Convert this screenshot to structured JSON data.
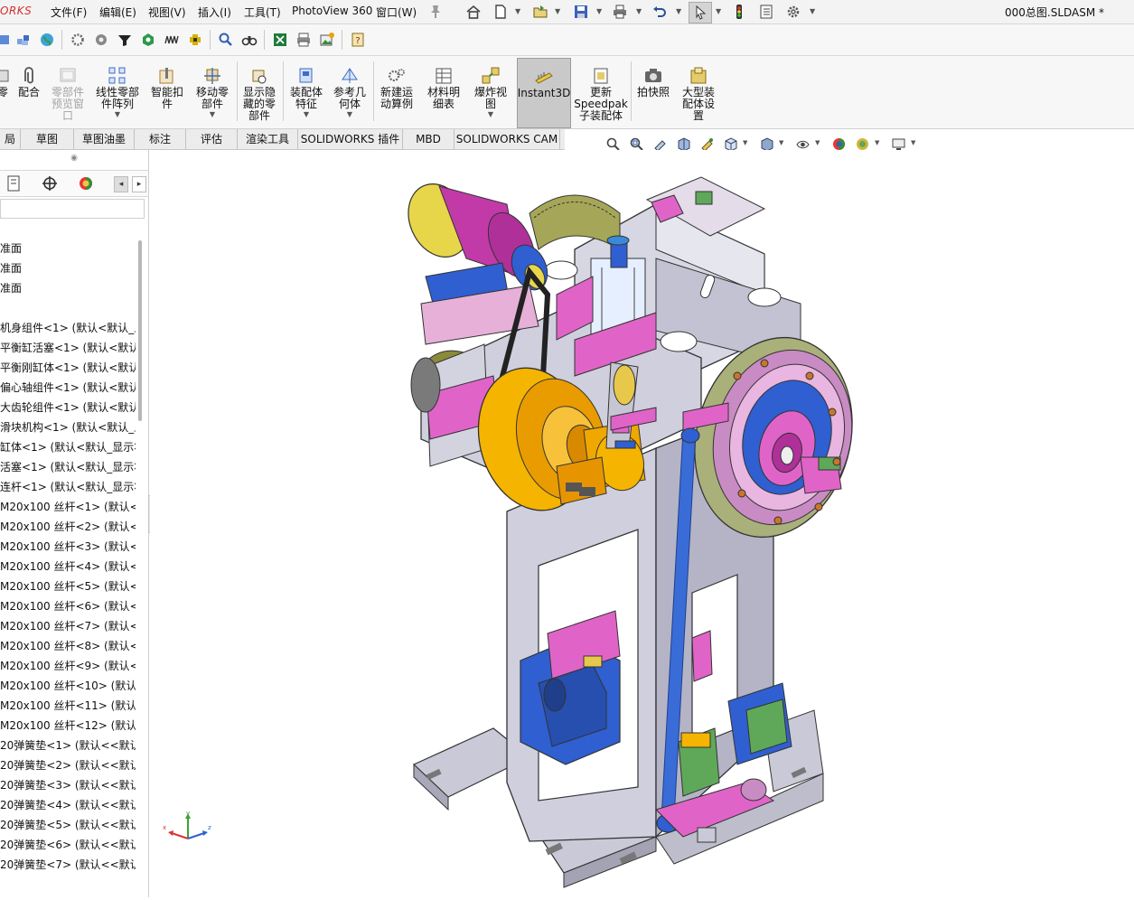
{
  "app": {
    "brand": "ORKS",
    "document_title": "000总图.SLDASM *"
  },
  "menu": [
    "文件(F)",
    "编辑(E)",
    "视图(V)",
    "插入(I)",
    "工具(T)",
    "PhotoView 360",
    "窗口(W)"
  ],
  "quick_access_icons": [
    "home-icon",
    "new-document-icon",
    "open-file-icon",
    "save-icon",
    "print-icon",
    "undo-icon",
    "select-pointer-icon",
    "traffic-light-icon",
    "file-properties-icon",
    "options-gear-icon"
  ],
  "toolbar2_icons": [
    "assembly-icon",
    "component-icon",
    "globe-icon",
    "settings-gear-icon",
    "gear-part-icon",
    "funnel-icon",
    "target-icon",
    "wave-icon",
    "plug-icon",
    "zoom-find-icon",
    "binoculars-icon",
    "excel-icon",
    "printer-icon",
    "image-import-icon",
    "help-book-icon"
  ],
  "command_manager": [
    {
      "id": "cmd-part",
      "label": "零",
      "icon": "part-icon",
      "has_dropdown": false,
      "disabled": false
    },
    {
      "id": "cmd-mate",
      "label": "配合",
      "icon": "paperclip-icon",
      "has_dropdown": false,
      "disabled": false
    },
    {
      "id": "cmd-preview",
      "label": "零部件\n预览窗\n口",
      "icon": "preview-window-icon",
      "has_dropdown": false,
      "disabled": true
    },
    {
      "id": "cmd-linear-pattern",
      "label": "线性零部\n件阵列",
      "icon": "linear-pattern-icon",
      "has_dropdown": true,
      "disabled": false
    },
    {
      "id": "cmd-smart-fastener",
      "label": "智能扣\n件",
      "icon": "smart-fastener-icon",
      "has_dropdown": false,
      "disabled": false
    },
    {
      "id": "cmd-move-component",
      "label": "移动零\n部件",
      "icon": "move-component-icon",
      "has_dropdown": true,
      "disabled": false
    },
    {
      "id": "cmd-show-hidden",
      "label": "显示隐\n藏的零\n部件",
      "icon": "show-hidden-icon",
      "has_dropdown": false,
      "disabled": false
    },
    {
      "id": "cmd-assembly-feature",
      "label": "装配体\n特征",
      "icon": "assembly-feature-icon",
      "has_dropdown": true,
      "disabled": false
    },
    {
      "id": "cmd-reference-geometry",
      "label": "参考几\n何体",
      "icon": "reference-geometry-icon",
      "has_dropdown": true,
      "disabled": false
    },
    {
      "id": "cmd-motion-study",
      "label": "新建运\n动算例",
      "icon": "motion-study-icon",
      "has_dropdown": false,
      "disabled": false
    },
    {
      "id": "cmd-bom",
      "label": "材料明\n细表",
      "icon": "bom-icon",
      "has_dropdown": false,
      "disabled": false
    },
    {
      "id": "cmd-exploded-view",
      "label": "爆炸视\n图",
      "icon": "exploded-view-icon",
      "has_dropdown": true,
      "disabled": false
    },
    {
      "id": "cmd-instant3d",
      "label": "Instant3D",
      "icon": "instant3d-icon",
      "has_dropdown": false,
      "disabled": false,
      "active": true
    },
    {
      "id": "cmd-speedpak",
      "label": "更新\nSpeedpak\n子装配体",
      "icon": "speedpak-icon",
      "has_dropdown": false,
      "disabled": false
    },
    {
      "id": "cmd-snapshot",
      "label": "拍快照",
      "icon": "camera-icon",
      "has_dropdown": false,
      "disabled": false
    },
    {
      "id": "cmd-large-assembly",
      "label": "大型装\n配体设\n置",
      "icon": "large-assembly-icon",
      "has_dropdown": false,
      "disabled": false
    }
  ],
  "tabs": [
    "局",
    "草图",
    "草图油墨",
    "标注",
    "评估",
    "渲染工具",
    "SOLIDWORKS 插件",
    "MBD",
    "SOLIDWORKS CAM"
  ],
  "heads_up_icons": [
    "zoom-to-fit-icon",
    "zoom-area-icon",
    "previous-view-icon",
    "section-view-icon",
    "dynamic-annotation-icon",
    "view-orientation-icon",
    "display-style-icon",
    "hide-show-icon",
    "edit-appearance-icon",
    "apply-scene-icon",
    "view-settings-icon"
  ],
  "panel": {
    "collapse_glyph": "◉",
    "tab_icons": [
      "property-manager-icon",
      "config-manager-icon",
      "display-manager-icon"
    ],
    "nav_left": "◂",
    "nav_right": "▸"
  },
  "tree": [
    "准面",
    "准面",
    "准面",
    "",
    "机身组件<1> (默认<默认_显",
    "平衡缸活塞<1> (默认<默认",
    "平衡刚缸体<1> (默认<默认",
    "偏心轴组件<1> (默认<默认",
    "大齿轮组件<1> (默认<默认",
    "滑块机构<1> (默认<默认_显",
    "缸体<1> (默认<默认_显示状",
    "活塞<1> (默认<默认_显示状",
    "连杆<1> (默认<默认_显示状",
    "M20x100 丝杆<1> (默认<",
    "M20x100 丝杆<2> (默认<",
    "M20x100 丝杆<3> (默认<",
    "M20x100 丝杆<4> (默认<",
    "M20x100 丝杆<5> (默认<",
    "M20x100 丝杆<6> (默认<",
    "M20x100 丝杆<7> (默认<",
    "M20x100 丝杆<8> (默认<",
    "M20x100 丝杆<9> (默认<",
    "M20x100 丝杆<10> (默认<",
    "M20x100 丝杆<11> (默认<",
    "M20x100 丝杆<12> (默认<",
    "20弹簧垫<1> (默认<<默认",
    "20弹簧垫<2> (默认<<默认",
    "20弹簧垫<3> (默认<<默认",
    "20弹簧垫<4> (默认<<默认",
    "20弹簧垫<5> (默认<<默认",
    "20弹簧垫<6> (默认<<默认",
    "20弹簧垫<7> (默认<<默认"
  ],
  "triad": {
    "x": "x",
    "y": "y",
    "z": "z"
  },
  "colors": {
    "frame": "#c7c7d6",
    "motor_yellow": "#e8d64a",
    "motor_magenta": "#c23aa8",
    "flywheel": "#f5b400",
    "blue_parts": "#2f5fd0",
    "pink_parts": "#e064c8",
    "olive_parts": "#8a8a3a",
    "green_parts": "#5fa85a"
  }
}
